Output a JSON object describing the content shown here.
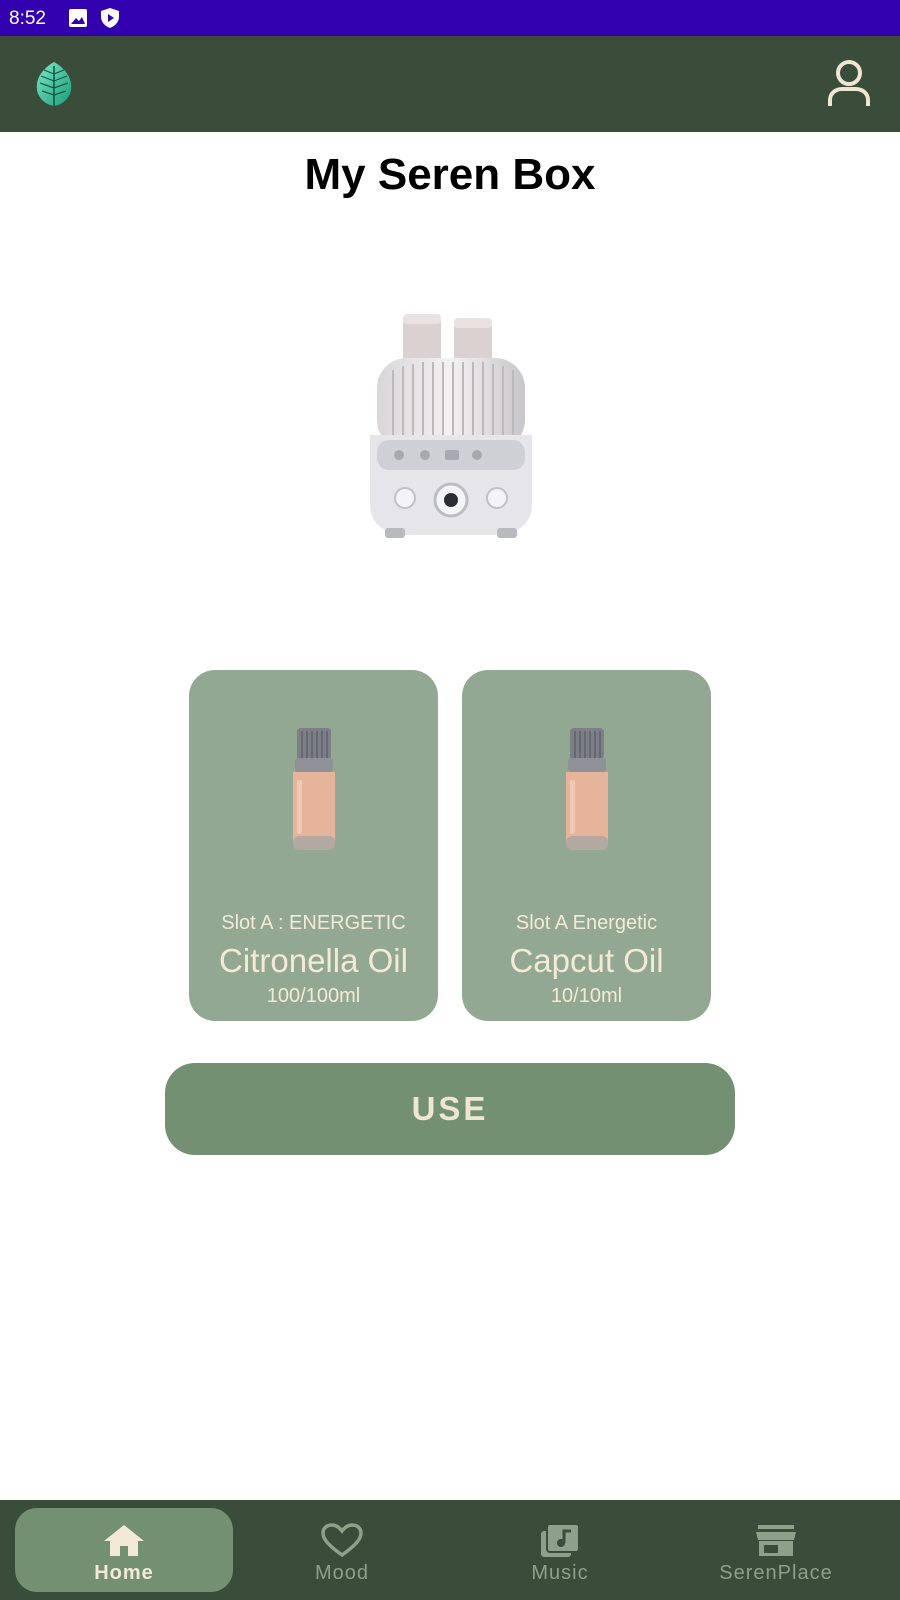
{
  "status_bar": {
    "time": "8:52",
    "icons": [
      "image-icon",
      "shield-icon"
    ]
  },
  "app_bar": {
    "logo_icon": "leaf-logo-icon",
    "profile_icon": "person-icon"
  },
  "page": {
    "title": "My Seren Box"
  },
  "slots": [
    {
      "slot_label": "Slot A : ENERGETIC",
      "oil_name": "Citronella Oil",
      "volume": "100/100ml"
    },
    {
      "slot_label": "Slot A Energetic",
      "oil_name": "Capcut Oil",
      "volume": "10/10ml"
    }
  ],
  "use_button": {
    "label": "USE"
  },
  "bottom_nav": {
    "items": [
      {
        "label": "Home",
        "icon": "home-icon",
        "active": true
      },
      {
        "label": "Mood",
        "icon": "heart-icon",
        "active": false
      },
      {
        "label": "Music",
        "icon": "music-library-icon",
        "active": false
      },
      {
        "label": "SerenPlace",
        "icon": "store-icon",
        "active": false
      }
    ]
  },
  "colors": {
    "status_bar": "#3300b0",
    "app_bar": "#3a4d3a",
    "card": "#93a893",
    "button": "#739172",
    "cream_text": "#f3ead6"
  }
}
